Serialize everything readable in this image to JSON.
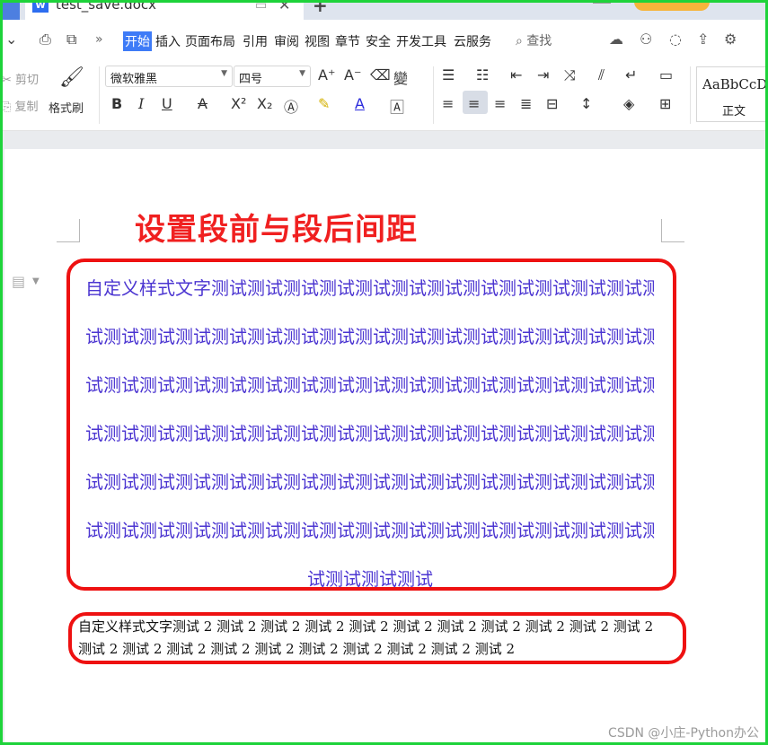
{
  "window": {
    "tab_title": "test_save.docx",
    "tab_icon": "W"
  },
  "menu": {
    "items": [
      "开始",
      "插入",
      "页面布局",
      "引用",
      "审阅",
      "视图",
      "章节",
      "安全",
      "开发工具",
      "云服务"
    ],
    "active": "开始",
    "search_label": "查找",
    "more": "»"
  },
  "ribbon": {
    "cut_label": "剪切",
    "copy_label": "复制",
    "format_painter_label": "格式刷",
    "font_name": "微软雅黑",
    "font_size": "四号",
    "style_sample": "AaBbCcD",
    "style_name": "正文"
  },
  "document": {
    "heading": "设置段前与段后间距",
    "para1": {
      "lines": [
        "自定义样式文字测试测试测试测试测试测试测试测试测试测试测试测试测",
        "试测试测试测试测试测试测试测试测试测试测试测试测试测试测试测试测",
        "试测试测试测试测试测试测试测试测试测试测试测试测试测试测试测试测",
        "试测试测试测试测试测试测试测试测试测试测试测试测试测试测试测试测",
        "试测试测试测试测试测试测试测试测试测试测试测试测试测试测试测试测",
        "试测试测试测试测试测试测试测试测试测试测试测试测试测试测试测试测"
      ],
      "last_line": "试测试测试测试"
    },
    "para2": "自定义样式文字测试 2 测试 2 测试 2 测试 2 测试 2 测试 2 测试 2 测试 2 测试 2 测试 2 测试 2 测试 2 测试 2 测试 2 测试 2 测试 2 测试 2 测试 2 测试 2 测试 2 测试 2",
    "colors": {
      "heading": "#f02020",
      "para1": "#4b35d1",
      "annotation_box": "#ee1111"
    }
  },
  "watermark": "CSDN @小庄-Python办公"
}
